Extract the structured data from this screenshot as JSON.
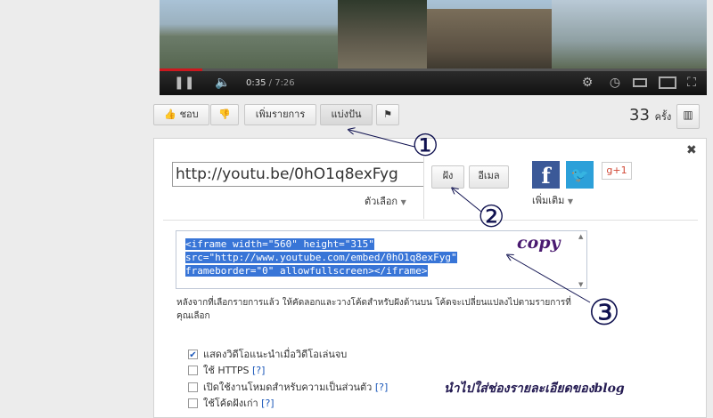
{
  "player": {
    "time_current": "0:35",
    "time_separator": " / ",
    "time_total": "7:26",
    "progress_fraction": 0.078,
    "icons": [
      "play-pause-icon",
      "volume-icon",
      "settings-icon",
      "watch-later-icon",
      "small-player-icon",
      "large-player-icon",
      "fullscreen-icon"
    ]
  },
  "actions": {
    "like_label": "ชอบ",
    "add_to_label": "เพิ่มรายการ",
    "share_label": "แบ่งปัน",
    "views_count": "33",
    "views_unit": "ครั้ง"
  },
  "share": {
    "url": "http://youtu.be/0hO1q8exFyg",
    "options_label": "ตัวเลือก",
    "embed_tab": "ฝัง",
    "email_tab": "อีเมล",
    "more_label": "เพิ่มเติม",
    "facebook_glyph": "f",
    "gplus_label": "g+1",
    "embed_code": {
      "line1": "<iframe width=\"560\" height=\"315\"",
      "line2": "src=\"http://www.youtube.com/embed/0hO1q8exFyg\"",
      "line3": "frameborder=\"0\" allowfullscreen></iframe>"
    },
    "help_text": "หลังจากที่เลือกรายการแล้ว ให้คัดลอกและวางโค้ดสำหรับฝังด้านบน โค้ดจะเปลี่ยนแปลงไปตามรายการที่คุณเลือก",
    "checkboxes": [
      {
        "label": "แสดงวิดีโอแนะนำเมื่อวิดีโอเล่นจบ",
        "checked": true,
        "help": ""
      },
      {
        "label": "ใช้ HTTPS",
        "checked": false,
        "help": "[?]"
      },
      {
        "label": "เปิดใช้งานโหมดสำหรับความเป็นส่วนตัว",
        "checked": false,
        "help": "[?]"
      },
      {
        "label": "ใช้โค้ดฝังเก่า",
        "checked": false,
        "help": "[?]"
      }
    ]
  },
  "annotations": {
    "num1": "①",
    "num2": "②",
    "num3": "③",
    "copy_note": "copy",
    "handwritten_note": "นำไปใส่ช่องรายละเอียดของblog"
  },
  "colors": {
    "progress_red": "#cc181e",
    "selection_blue": "#3875d7",
    "annotation_ink": "#101250"
  }
}
